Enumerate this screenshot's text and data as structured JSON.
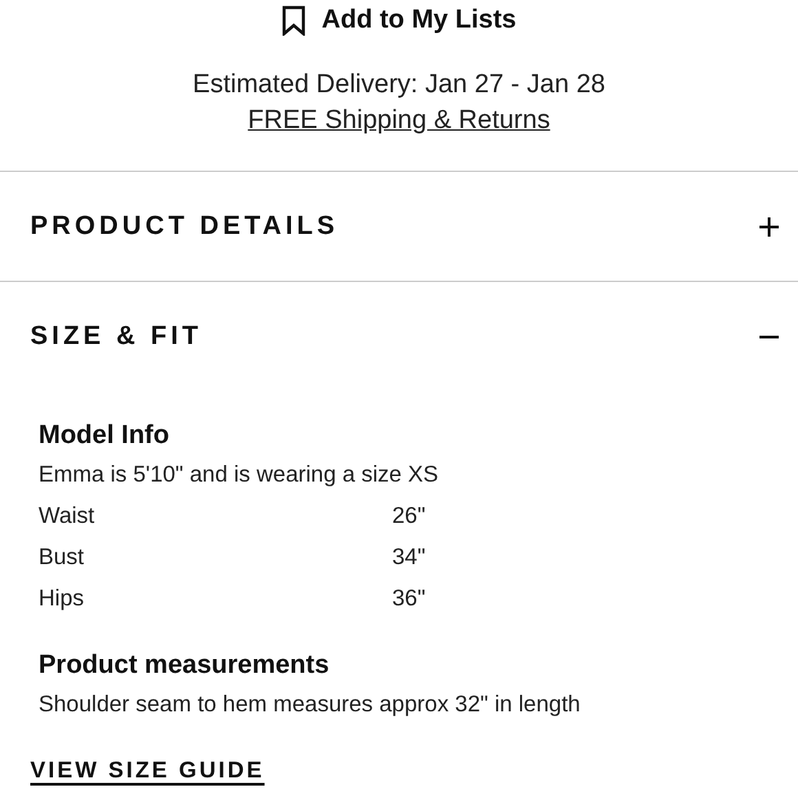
{
  "add_to_list": {
    "label": "Add to My Lists"
  },
  "delivery": {
    "estimate": "Estimated Delivery: Jan 27 - Jan 28",
    "shipping_link": "FREE Shipping & Returns"
  },
  "sections": [
    {
      "title": "PRODUCT DETAILS",
      "expanded": false
    },
    {
      "title": "SIZE & FIT",
      "expanded": true
    }
  ],
  "size_fit": {
    "model_info": {
      "heading": "Model Info",
      "description": "Emma is 5'10\" and is wearing a size XS",
      "measurements": [
        {
          "label": "Waist",
          "value": "26\""
        },
        {
          "label": "Bust",
          "value": "34\""
        },
        {
          "label": "Hips",
          "value": "36\""
        }
      ]
    },
    "product_measurements": {
      "heading": "Product measurements",
      "text": "Shoulder seam to hem measures approx 32\" in length"
    }
  },
  "size_guide_link": "VIEW SIZE GUIDE"
}
